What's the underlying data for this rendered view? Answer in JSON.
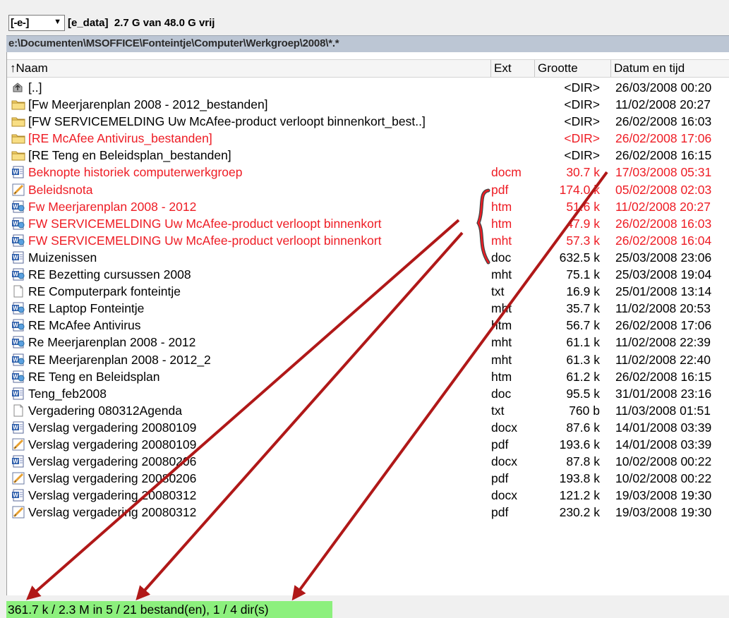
{
  "drive": {
    "selector_label": "[-e-]",
    "info_label": "[e_data]",
    "info_space": "2.7 G van 48.0 G vrij"
  },
  "path": "e:\\Documenten\\MSOFFICE\\Fonteintje\\Computer\\Werkgroep\\2008\\*.*",
  "columns": {
    "name": "↑Naam",
    "ext": "Ext",
    "size": "Grootte",
    "date": "Datum en tijd"
  },
  "files": [
    {
      "name": "[..]",
      "ext": "",
      "size": "<DIR>",
      "date": "26/03/2008 00:20",
      "icon": "up-folder",
      "selected": false
    },
    {
      "name": "[Fw Meerjarenplan 2008 - 2012_bestanden]",
      "ext": "",
      "size": "<DIR>",
      "date": "11/02/2008 20:27",
      "icon": "folder",
      "selected": false
    },
    {
      "name": "[FW SERVICEMELDING Uw McAfee-product verloopt binnenkort_best..]",
      "ext": "",
      "size": "<DIR>",
      "date": "26/02/2008 16:03",
      "icon": "folder",
      "selected": false
    },
    {
      "name": "[RE McAfee Antivirus_bestanden]",
      "ext": "",
      "size": "<DIR>",
      "date": "26/02/2008 17:06",
      "icon": "folder",
      "selected": true
    },
    {
      "name": "[RE Teng en Beleidsplan_bestanden]",
      "ext": "",
      "size": "<DIR>",
      "date": "26/02/2008 16:15",
      "icon": "folder",
      "selected": false
    },
    {
      "name": "Beknopte historiek computerwerkgroep",
      "ext": "docm",
      "size": "30.7 k",
      "date": "17/03/2008 05:31",
      "icon": "word",
      "selected": true
    },
    {
      "name": "Beleidsnota",
      "ext": "pdf",
      "size": "174.0 k",
      "date": "05/02/2008 02:03",
      "icon": "pdf",
      "selected": true
    },
    {
      "name": "Fw Meerjarenplan 2008 - 2012",
      "ext": "htm",
      "size": "51.6 k",
      "date": "11/02/2008 20:27",
      "icon": "web",
      "selected": true
    },
    {
      "name": "FW SERVICEMELDING Uw McAfee-product verloopt binnenkort",
      "ext": "htm",
      "size": "47.9 k",
      "date": "26/02/2008 16:03",
      "icon": "web",
      "selected": true
    },
    {
      "name": "FW SERVICEMELDING Uw McAfee-product verloopt binnenkort",
      "ext": "mht",
      "size": "57.3 k",
      "date": "26/02/2008 16:04",
      "icon": "web",
      "selected": true
    },
    {
      "name": "Muizenissen",
      "ext": "doc",
      "size": "632.5 k",
      "date": "25/03/2008 23:06",
      "icon": "word",
      "selected": false
    },
    {
      "name": "RE Bezetting cursussen 2008",
      "ext": "mht",
      "size": "75.1 k",
      "date": "25/03/2008 19:04",
      "icon": "web",
      "selected": false
    },
    {
      "name": "RE Computerpark fonteintje",
      "ext": "txt",
      "size": "16.9 k",
      "date": "25/01/2008 13:14",
      "icon": "text",
      "selected": false
    },
    {
      "name": "RE Laptop Fonteintje",
      "ext": "mht",
      "size": "35.7 k",
      "date": "11/02/2008 20:53",
      "icon": "web",
      "selected": false
    },
    {
      "name": "RE McAfee Antivirus",
      "ext": "htm",
      "size": "56.7 k",
      "date": "26/02/2008 17:06",
      "icon": "web",
      "selected": false
    },
    {
      "name": "Re Meerjarenplan 2008 - 2012",
      "ext": "mht",
      "size": "61.1 k",
      "date": "11/02/2008 22:39",
      "icon": "web",
      "selected": false
    },
    {
      "name": "RE Meerjarenplan 2008 - 2012_2",
      "ext": "mht",
      "size": "61.3 k",
      "date": "11/02/2008 22:40",
      "icon": "web",
      "selected": false
    },
    {
      "name": "RE Teng en Beleidsplan",
      "ext": "htm",
      "size": "61.2 k",
      "date": "26/02/2008 16:15",
      "icon": "web",
      "selected": false
    },
    {
      "name": "Teng_feb2008",
      "ext": "doc",
      "size": "95.5 k",
      "date": "31/01/2008 23:16",
      "icon": "word",
      "selected": false
    },
    {
      "name": "Vergadering 080312Agenda",
      "ext": "txt",
      "size": "760 b",
      "date": "11/03/2008 01:51",
      "icon": "text",
      "selected": false
    },
    {
      "name": "Verslag vergadering 20080109",
      "ext": "docx",
      "size": "87.6 k",
      "date": "14/01/2008 03:39",
      "icon": "word",
      "selected": false
    },
    {
      "name": "Verslag vergadering 20080109",
      "ext": "pdf",
      "size": "193.6 k",
      "date": "14/01/2008 03:39",
      "icon": "pdf",
      "selected": false
    },
    {
      "name": "Verslag vergadering 20080206",
      "ext": "docx",
      "size": "87.8 k",
      "date": "10/02/2008 00:22",
      "icon": "word",
      "selected": false
    },
    {
      "name": "Verslag vergadering 20080206",
      "ext": "pdf",
      "size": "193.8 k",
      "date": "10/02/2008 00:22",
      "icon": "pdf",
      "selected": false
    },
    {
      "name": "Verslag vergadering 20080312",
      "ext": "docx",
      "size": "121.2 k",
      "date": "19/03/2008 19:30",
      "icon": "word",
      "selected": false
    },
    {
      "name": "Verslag vergadering 20080312",
      "ext": "pdf",
      "size": "230.2 k",
      "date": "19/03/2008 19:30",
      "icon": "pdf",
      "selected": false
    }
  ],
  "status": "361.7 k / 2.3 M in 5 / 21 bestand(en), 1 / 4 dir(s)",
  "colors": {
    "selected": "#ee1c24",
    "status_bg": "#8cf07d",
    "arrow": "#b01818"
  }
}
